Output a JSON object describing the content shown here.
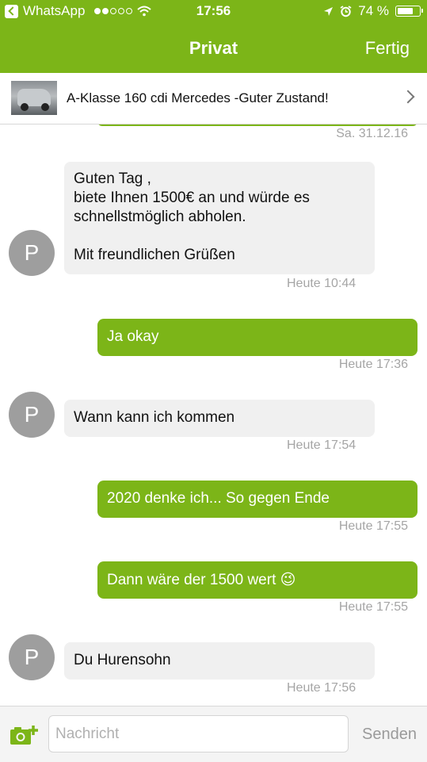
{
  "status": {
    "app": "WhatsApp",
    "time": "17:56",
    "battery": "74 %",
    "battery_level": 0.74
  },
  "nav": {
    "title": "Privat",
    "done": "Fertig"
  },
  "listing": {
    "title": "A-Klasse 160 cdi Mercedes -Guter Zustand!"
  },
  "chat": {
    "date_stamp": "Sa. 31.12.16",
    "messages": [
      {
        "dir": "in",
        "avatar": "P",
        "lines": [
          "Guten Tag ,",
          "biete Ihnen 1500€ an und würde es",
          "schnellstmöglich abholen.",
          "",
          "Mit freundlichen Grüßen"
        ],
        "time": "Heute 10:44"
      },
      {
        "dir": "out",
        "text": "Ja okay",
        "time": "Heute 17:36"
      },
      {
        "dir": "in",
        "avatar": "P",
        "text": "Wann kann ich kommen",
        "time": "Heute 17:54"
      },
      {
        "dir": "out",
        "text": "2020 denke ich... So gegen Ende",
        "time": "Heute 17:55"
      },
      {
        "dir": "out",
        "text": "Dann wäre der 1500 wert",
        "emoji": "😉",
        "time": "Heute 17:55"
      },
      {
        "dir": "in",
        "avatar": "P",
        "text": "Du Hurensohn",
        "time": "Heute 17:56"
      }
    ]
  },
  "input": {
    "placeholder": "Nachricht",
    "send": "Senden"
  },
  "colors": {
    "accent": "#7cb518",
    "incoming": "#f0f0f0",
    "avatar": "#9e9e9e"
  },
  "icons": [
    "back-icon",
    "wifi-icon",
    "location-icon",
    "alarm-icon",
    "battery-icon",
    "chevron-right-icon",
    "camera-add-icon"
  ]
}
